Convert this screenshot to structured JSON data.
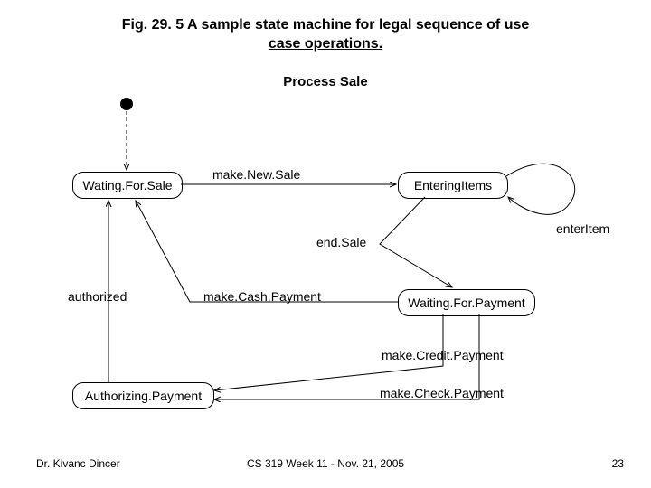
{
  "title_line1": "Fig. 29. 5 A sample state machine for legal sequence of use",
  "title_line2": "case operations.",
  "subtitle": "Process Sale",
  "states": {
    "waiting_for_sale": "Wating.For.Sale",
    "entering_items": "EnteringItems",
    "waiting_for_payment": "Waiting.For.Payment",
    "authorizing_payment": "Authorizing.Payment"
  },
  "transitions": {
    "make_new_sale": "make.New.Sale",
    "enter_item": "enterItem",
    "end_sale": "end.Sale",
    "make_cash_payment": "make.Cash.Payment",
    "make_credit_payment": "make.Credit.Payment",
    "make_check_payment": "make.Check.Payment",
    "authorized": "authorized"
  },
  "footer": {
    "author": "Dr. Kivanc Dincer",
    "course": "CS 319 Week 11 - Nov. 21, 2005",
    "page": "23"
  }
}
